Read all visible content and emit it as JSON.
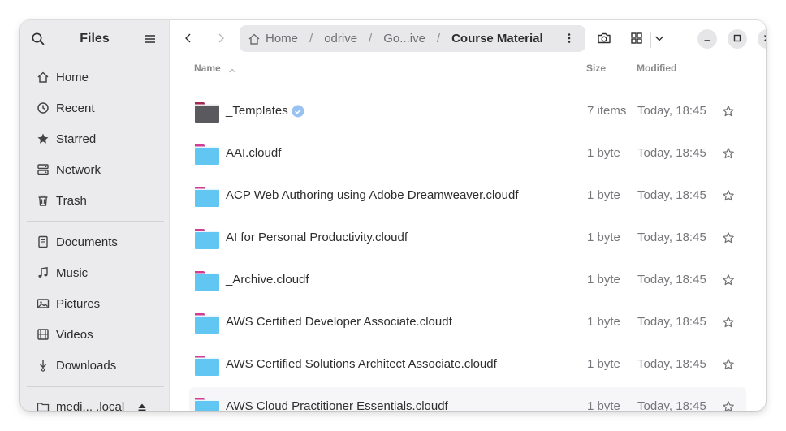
{
  "sidebar": {
    "title": "Files",
    "places": [
      {
        "label": "Home",
        "icon": "home-icon"
      },
      {
        "label": "Recent",
        "icon": "clock-icon"
      },
      {
        "label": "Starred",
        "icon": "star-icon"
      },
      {
        "label": "Network",
        "icon": "network-icon"
      },
      {
        "label": "Trash",
        "icon": "trash-icon"
      }
    ],
    "bookmarks": [
      {
        "label": "Documents",
        "icon": "document-icon"
      },
      {
        "label": "Music",
        "icon": "music-icon"
      },
      {
        "label": "Pictures",
        "icon": "picture-icon"
      },
      {
        "label": "Videos",
        "icon": "film-icon"
      },
      {
        "label": "Downloads",
        "icon": "download-icon"
      }
    ],
    "mount": {
      "label": "medi... .local",
      "icon": "folder-icon"
    }
  },
  "pathbar": {
    "crumbs": [
      "Home",
      "odrive",
      "Go...ive",
      "Course Material"
    ],
    "separator": "/"
  },
  "columns": {
    "name": "Name",
    "size": "Size",
    "modified": "Modified"
  },
  "files": [
    {
      "name": "_Templates",
      "size": "7 items",
      "modified": "Today, 18:45",
      "kind": "templates",
      "verified": true
    },
    {
      "name": "AAI.cloudf",
      "size": "1 byte",
      "modified": "Today, 18:45",
      "kind": "folder"
    },
    {
      "name": "ACP Web Authoring using Adobe Dreamweaver.cloudf",
      "size": "1 byte",
      "modified": "Today, 18:45",
      "kind": "folder"
    },
    {
      "name": "AI for Personal Productivity.cloudf",
      "size": "1 byte",
      "modified": "Today, 18:45",
      "kind": "folder"
    },
    {
      "name": "_Archive.cloudf",
      "size": "1 byte",
      "modified": "Today, 18:45",
      "kind": "folder"
    },
    {
      "name": "AWS Certified Developer Associate.cloudf",
      "size": "1 byte",
      "modified": "Today, 18:45",
      "kind": "folder"
    },
    {
      "name": "AWS Certified Solutions Architect Associate.cloudf",
      "size": "1 byte",
      "modified": "Today, 18:45",
      "kind": "folder"
    },
    {
      "name": "AWS Cloud Practitioner Essentials.cloudf",
      "size": "1 byte",
      "modified": "Today, 18:45",
      "kind": "folder"
    }
  ],
  "colors": {
    "sidebar_bg": "#ebebed",
    "folder_blue": "#62c6f2",
    "folder_tab": "#d33c93",
    "template_folder": "#5a5a5e",
    "verified": "#99c1f1"
  }
}
